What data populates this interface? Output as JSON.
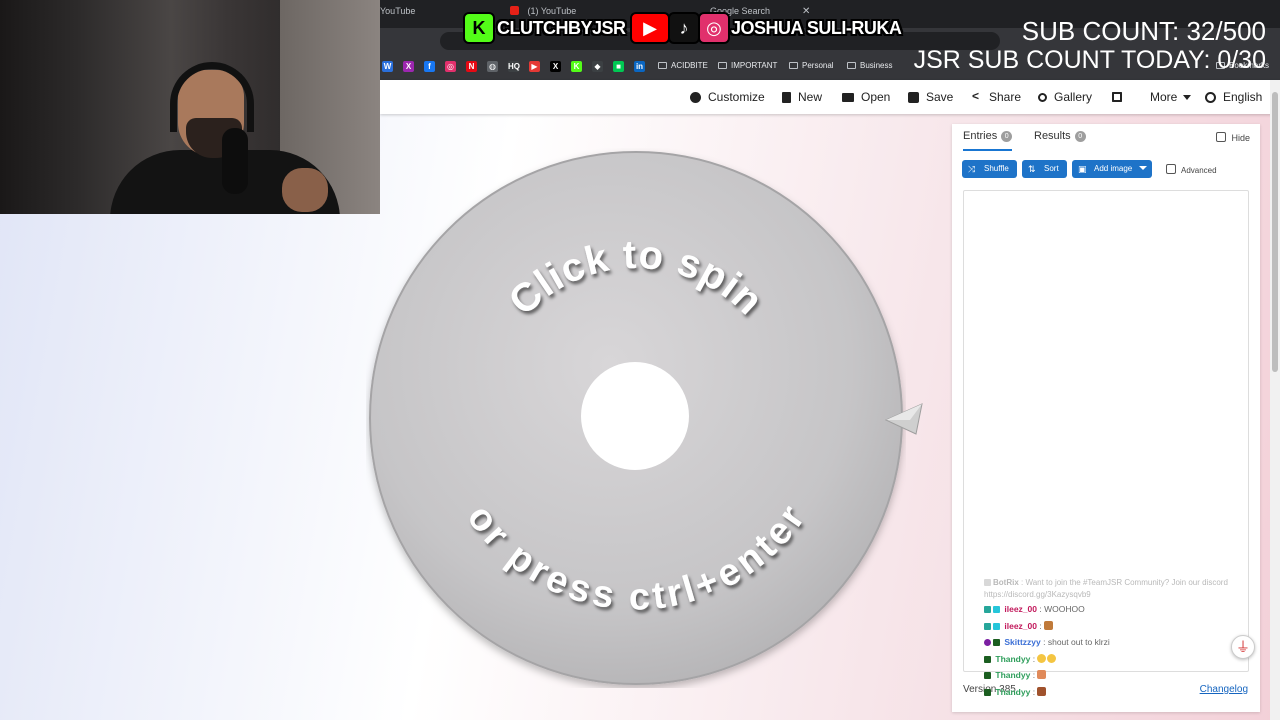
{
  "browser": {
    "tabs": [
      {
        "label": "YouTube"
      },
      {
        "label": "(1) YouTube"
      },
      {
        "label": "Google Search"
      }
    ],
    "bookmarks": [
      {
        "icon": "w-icon",
        "color": "#2a6fdb",
        "glyph": "W"
      },
      {
        "icon": "kick-x-icon",
        "color": "#9c27b0",
        "glyph": "X"
      },
      {
        "icon": "facebook-icon",
        "color": "#1877f2",
        "glyph": "f"
      },
      {
        "icon": "instagram-icon",
        "color": "#e1306c",
        "glyph": "◎"
      },
      {
        "icon": "netflix-icon",
        "color": "#e50914",
        "glyph": "N"
      },
      {
        "icon": "globe-icon",
        "color": "#5f6368",
        "glyph": "◍"
      },
      {
        "icon": "hq-icon",
        "color": "#3c4043",
        "glyph": "HQ"
      },
      {
        "icon": "streamlabs-icon",
        "color": "#e53935",
        "glyph": "▶"
      },
      {
        "icon": "x-twitter-icon",
        "color": "#000000",
        "glyph": "X"
      },
      {
        "icon": "kick-icon",
        "color": "#53fc18",
        "glyph": "K"
      },
      {
        "icon": "diamond-icon",
        "color": "#3c4043",
        "glyph": "◆"
      },
      {
        "icon": "green-app-icon",
        "color": "#00c853",
        "glyph": "■"
      },
      {
        "icon": "linkedin-icon",
        "color": "#0a66c2",
        "glyph": "in"
      }
    ],
    "bookmark_links": [
      "ACIDBITE",
      "IMPORTANT",
      "Personal",
      "Business"
    ],
    "bookmark_tail": "Bookmarks"
  },
  "overlay": {
    "kick_handle": "CLUTCHBYJSR",
    "name": "JOSHUA SULI-RUKA",
    "sub_count": "SUB COUNT: 32/500",
    "sub_today": "JSR SUB COUNT TODAY: 0/30"
  },
  "toolbar": {
    "customize": "Customize",
    "new": "New",
    "open": "Open",
    "save": "Save",
    "share": "Share",
    "gallery": "Gallery",
    "more": "More",
    "language": "English"
  },
  "wheel": {
    "top_text": "Click to spin",
    "bottom_text": "or press ctrl+enter"
  },
  "panel": {
    "entries_tab": "Entries",
    "entries_count": "0",
    "results_tab": "Results",
    "results_count": "0",
    "hide_label": "Hide",
    "shuffle": "Shuffle",
    "sort": "Sort",
    "add_image": "Add image",
    "advanced": "Advanced",
    "version": "Version 385",
    "changelog": "Changelog"
  },
  "chat": [
    {
      "user": "BotRix",
      "msg": ": Want to join the #TeamJSR Community? Join our discord https://discord.gg/3Kazysqvb9",
      "color": "#7a7a7a",
      "faded": true
    },
    {
      "user": "ileez_00",
      "msg": ": WOOHOO",
      "color": "#c2185b",
      "faded": false
    },
    {
      "user": "ileez_00",
      "msg": ":",
      "color": "#c2185b",
      "faded": false
    },
    {
      "user": "Skittzzyy",
      "msg": ": shout out to klrzi",
      "color": "#3b6fd6",
      "faded": false
    },
    {
      "user": "Thandyy",
      "msg": ":",
      "color": "#2e9e5b",
      "faded": false
    },
    {
      "user": "Thandyy",
      "msg": ":",
      "color": "#2e9e5b",
      "faded": false
    },
    {
      "user": "Thandyy",
      "msg": ":",
      "color": "#2e9e5b",
      "faded": false
    }
  ],
  "colors": {
    "accent": "#1e73c8",
    "wheel_fill": "#c9c8ca",
    "chat_green": "#2e9e5b"
  }
}
